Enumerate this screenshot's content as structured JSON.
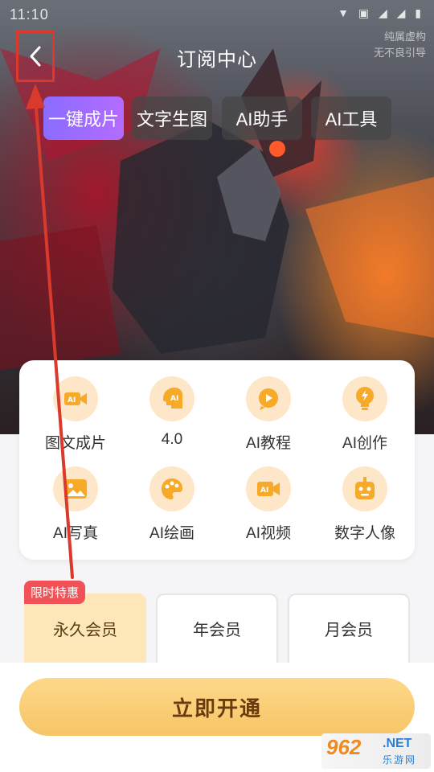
{
  "status_bar": {
    "time": "11:10",
    "icons": "▼ ▣  ◢ ◢ ▮"
  },
  "watermark": {
    "line1": "纯属虚构",
    "line2": "无不良引导"
  },
  "header": {
    "title": "订阅中心"
  },
  "tabs": [
    {
      "label": "一键成片",
      "active": true
    },
    {
      "label": "文字生图",
      "active": false
    },
    {
      "label": "AI助手",
      "active": false
    },
    {
      "label": "AI工具",
      "active": false
    }
  ],
  "features": [
    {
      "label": "图文成片",
      "icon": "video-camera-icon"
    },
    {
      "label": "4.0",
      "icon": "ai-head-icon"
    },
    {
      "label": "AI教程",
      "icon": "play-bubble-icon"
    },
    {
      "label": "AI创作",
      "icon": "lightbulb-icon"
    },
    {
      "label": "AI写真",
      "icon": "image-icon"
    },
    {
      "label": "AI绘画",
      "icon": "palette-icon"
    },
    {
      "label": "AI视频",
      "icon": "ai-video-icon"
    },
    {
      "label": "数字人像",
      "icon": "robot-icon"
    }
  ],
  "plans": {
    "badge": "限时特惠",
    "items": [
      {
        "label": "永久会员",
        "selected": true
      },
      {
        "label": "年会员",
        "selected": false
      },
      {
        "label": "月会员",
        "selected": false
      }
    ]
  },
  "cta": {
    "label": "立即开通"
  },
  "site_logo": {
    "number": "962",
    "suffix": ".NET",
    "cn": "乐游网"
  },
  "colors": {
    "accent_purple": "#8a6cff",
    "icon_bg": "#fde7c8",
    "icon_fg": "#f7a928",
    "cta": "#fdd889",
    "badge": "#f05257",
    "annotation": "#d93a2b"
  }
}
